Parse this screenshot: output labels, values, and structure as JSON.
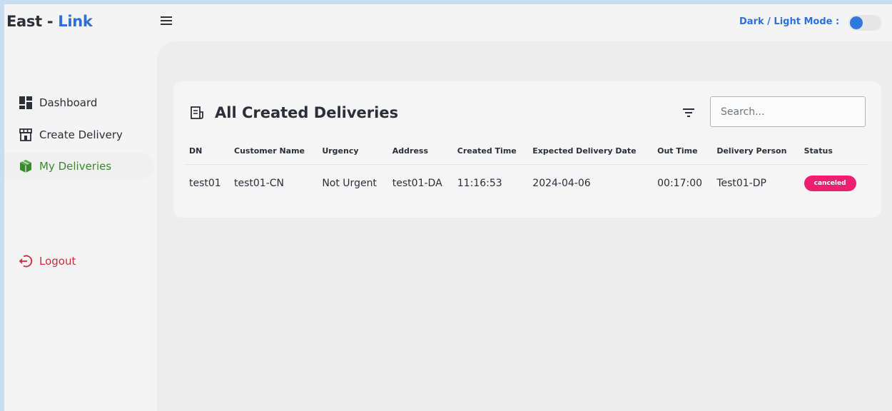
{
  "header": {
    "brand_prefix": "East - ",
    "brand_accent": "Link",
    "mode_label": "Dark / Light Mode :",
    "accent_color": "#2f6fd8"
  },
  "sidebar": {
    "items": [
      {
        "label": "Dashboard",
        "icon": "dashboard-icon"
      },
      {
        "label": "Create Delivery",
        "icon": "store-icon"
      },
      {
        "label": "My Deliveries",
        "icon": "package-icon"
      }
    ],
    "logout_label": "Logout"
  },
  "main": {
    "title": "All Created Deliveries",
    "search_placeholder": "Search...",
    "table": {
      "columns": [
        "DN",
        "Customer Name",
        "Urgency",
        "Address",
        "Created Time",
        "Expected Delivery Date",
        "Out Time",
        "Delivery Person",
        "Status"
      ],
      "rows": [
        {
          "dn": "test01",
          "customer_name": "test01-CN",
          "urgency": "Not Urgent",
          "address": "test01-DA",
          "created_time": "11:16:53",
          "expected_date": "2024-04-06",
          "out_time": "00:17:00",
          "delivery_person": "Test01-DP",
          "status": "canceled"
        }
      ]
    },
    "status_color": "#ef1f6f"
  }
}
